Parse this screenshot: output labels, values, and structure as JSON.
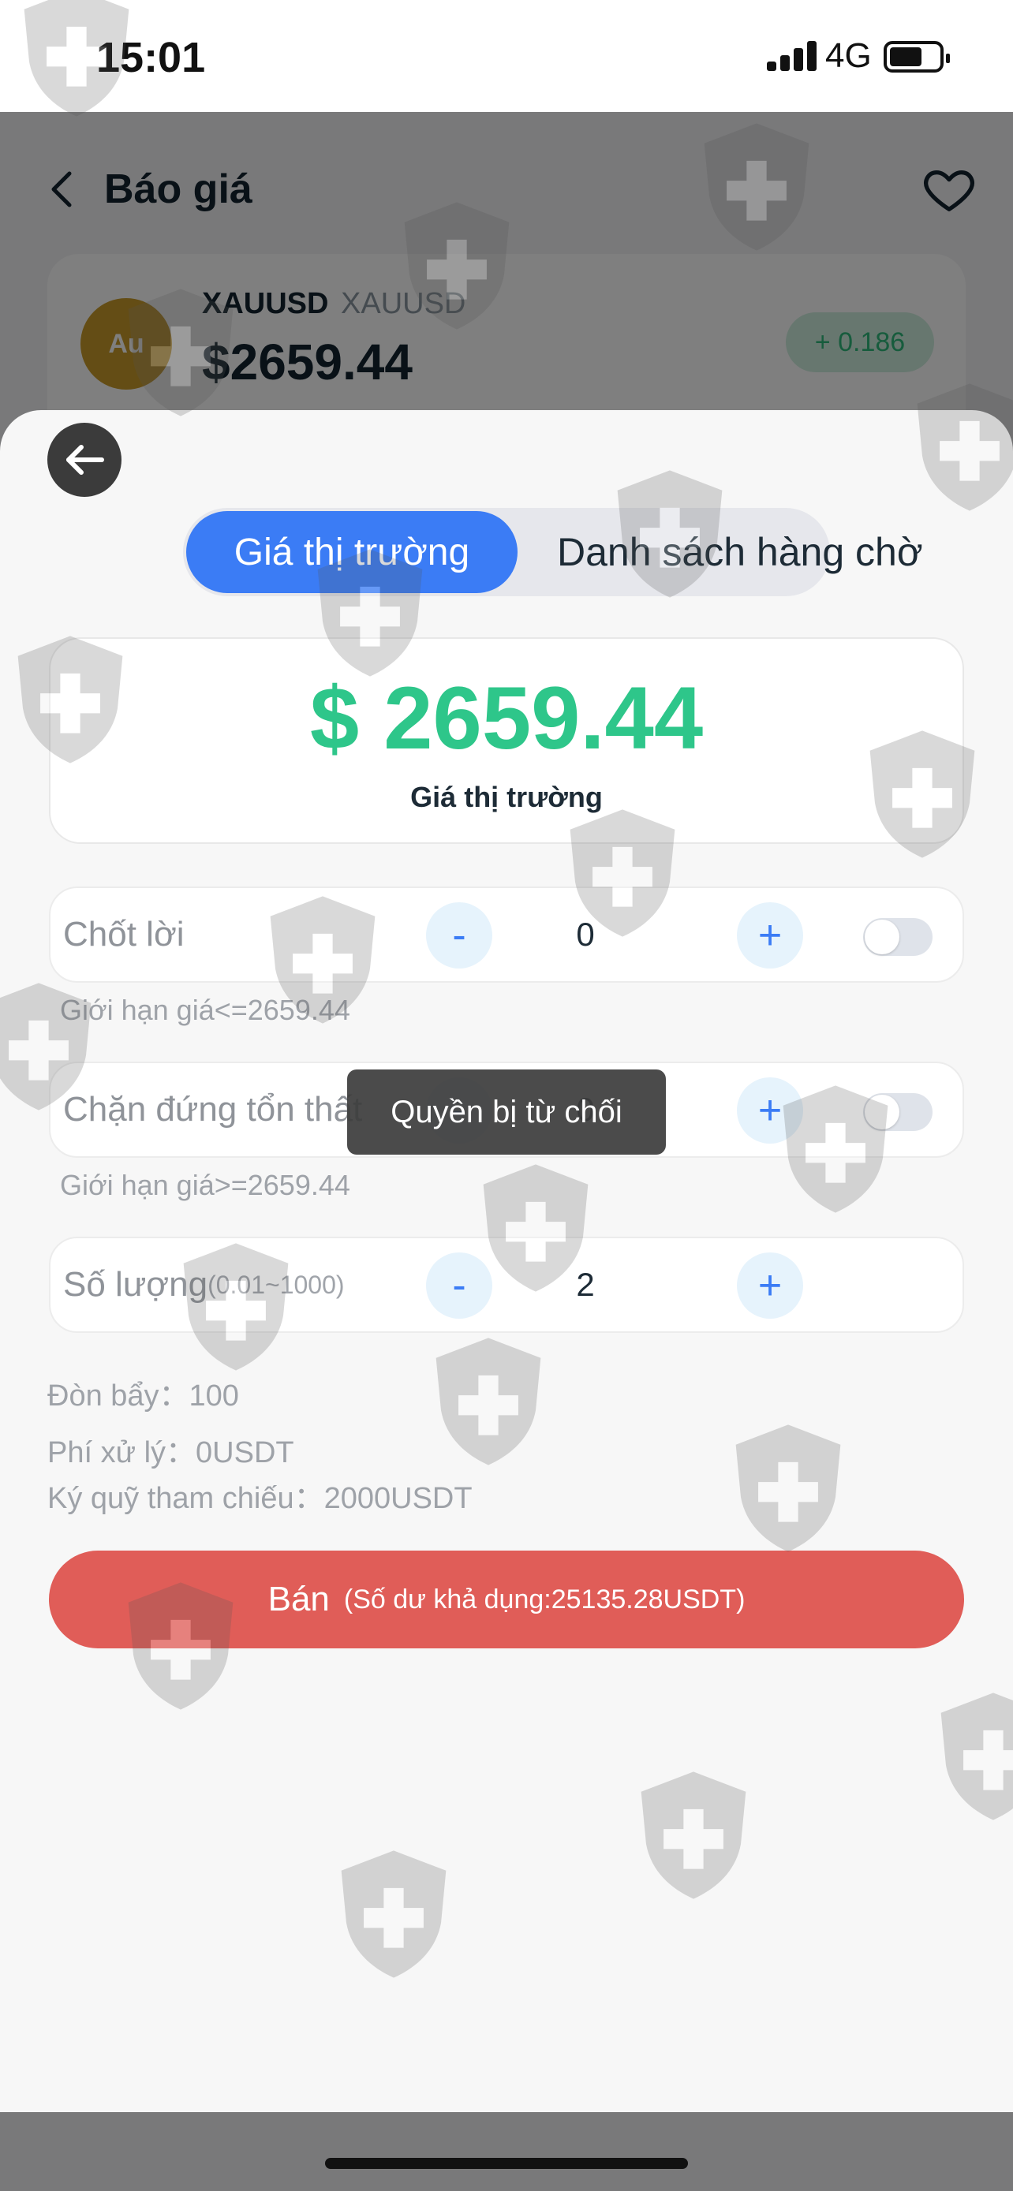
{
  "status": {
    "time": "15:01",
    "network": "4G"
  },
  "header": {
    "title": "Báo giá"
  },
  "quote": {
    "coin_label": "Au",
    "symbol": "XAUUSD",
    "symbol_alt": "XAUUSD",
    "price": "$2659.44",
    "change": "+ 0.186"
  },
  "tabs": {
    "active": "Giá thị trường",
    "inactive": "Danh sách hàng chờ"
  },
  "market": {
    "price": "$ 2659.44",
    "caption": "Giá thị trường"
  },
  "take_profit": {
    "label": "Chốt lời",
    "minus": "-",
    "value": "0",
    "plus": "+",
    "hint": "Giới hạn giá<=2659.44"
  },
  "stop_loss": {
    "label": "Chặn đứng tổn thất",
    "minus": "-",
    "value": "0",
    "plus": "+",
    "hint": "Giới hạn giá>=2659.44"
  },
  "quantity": {
    "label": "Số lượng",
    "range": "(0.01~1000)",
    "minus": "-",
    "value": "2",
    "plus": "+"
  },
  "info": {
    "leverage": "Đòn bẩy：100",
    "fee": "Phí xử lý：0USDT",
    "margin": "Ký quỹ tham chiếu：2000USDT"
  },
  "toast": "Quyền bị từ chối",
  "sell": {
    "label": "Bán",
    "balance": "(Số dư khả dụng:25135.28USDT)"
  },
  "colors": {
    "accent": "#3b7cf5",
    "price_green": "#2ec68a",
    "sell_red": "#e05d58",
    "gold": "#c99b2a"
  }
}
